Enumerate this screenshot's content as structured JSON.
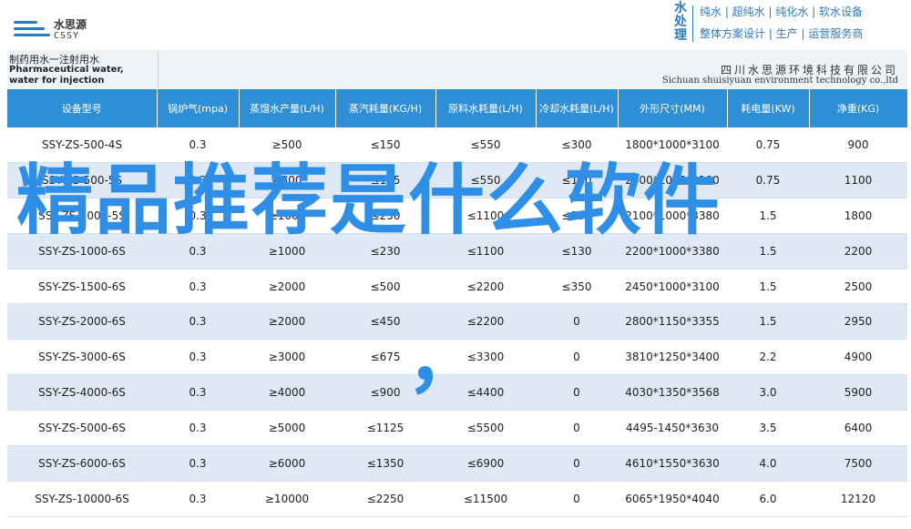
{
  "header": {
    "logo_cn": "水思源",
    "logo_en": "CSSY",
    "brand_vertical": "水处理",
    "brand_line1": "纯水 | 超纯水 | 纯化水 | 软水设备",
    "brand_line2": "整体方案设计 | 生产 | 运营服务商"
  },
  "title": {
    "cn": "制药用水一注射用水",
    "en": "Pharmaceutical water, water for injection",
    "company_cn": "四川水思源环境科技有限公司",
    "company_en": "Sichuan shuisiyuan environment technology co.,ltd"
  },
  "table": {
    "headers": [
      "设备型号",
      "锅炉气(mpa)",
      "蒸馏水产量(L/H)",
      "蒸汽耗量(KG/H)",
      "原料水耗量(L/H)",
      "冷却水耗量(L/H)",
      "外形尺寸(MM)",
      "耗电量(KW)",
      "净重(KG)"
    ],
    "rows": [
      [
        "SSY-ZS-500-4S",
        "0.3",
        "≥500",
        "≤150",
        "≤550",
        "≤300",
        "1800*1000*3100",
        "0.75",
        "900"
      ],
      [
        "SSY-ZS-500-5S",
        "0.3",
        "≥500",
        "≤125",
        "≤550",
        "≤120",
        "2000*1000*3100",
        "0.75",
        "1100"
      ],
      [
        "SSY-ZS-1000-5S",
        "0.3",
        "≥1000",
        "≤250",
        "≤1100",
        "≤230",
        "2100*1000*3380",
        "1.5",
        "1800"
      ],
      [
        "SSY-ZS-1000-6S",
        "0.3",
        "≥1000",
        "≤230",
        "≤1100",
        "≤130",
        "2200*1000*3380",
        "1.5",
        "2200"
      ],
      [
        "SSY-ZS-1500-6S",
        "0.3",
        "≥2000",
        "≤500",
        "≤2200",
        "≤350",
        "2450*1000*3100",
        "1.5",
        "2500"
      ],
      [
        "SSY-ZS-2000-6S",
        "0.3",
        "≥2000",
        "≤450",
        "≤2200",
        "0",
        "2800*1150*3355",
        "1.5",
        "2950"
      ],
      [
        "SSY-ZS-3000-6S",
        "0.3",
        "≥3000",
        "≤675",
        "≤3300",
        "0",
        "3810*1250*3400",
        "2.2",
        "4900"
      ],
      [
        "SSY-ZS-4000-6S",
        "0.3",
        "≥4000",
        "≤900",
        "≤4400",
        "0",
        "4030*1350*3568",
        "3.0",
        "5900"
      ],
      [
        "SSY-ZS-5000-6S",
        "0.3",
        "≥5000",
        "≤1125",
        "≤5500",
        "0",
        "4495-1450*3630",
        "3.5",
        "6400"
      ],
      [
        "SSY-ZS-6000-6S",
        "0.3",
        "≥6000",
        "≤1350",
        "≤6900",
        "0",
        "4610*1550*3630",
        "4.0",
        "7500"
      ],
      [
        "SSY-ZS-10000-6S",
        "0.3",
        "≥10000",
        "≤2250",
        "≤11500",
        "0",
        "6065*1950*4040",
        "6.0",
        "12120"
      ]
    ]
  },
  "overlay": {
    "text": "精品推荐是什么软件",
    "comma": "，"
  },
  "colors": {
    "header_blue": "#2f8fd6",
    "row_alt": "#dfe9f5",
    "overlay": "#2f8fe6"
  }
}
